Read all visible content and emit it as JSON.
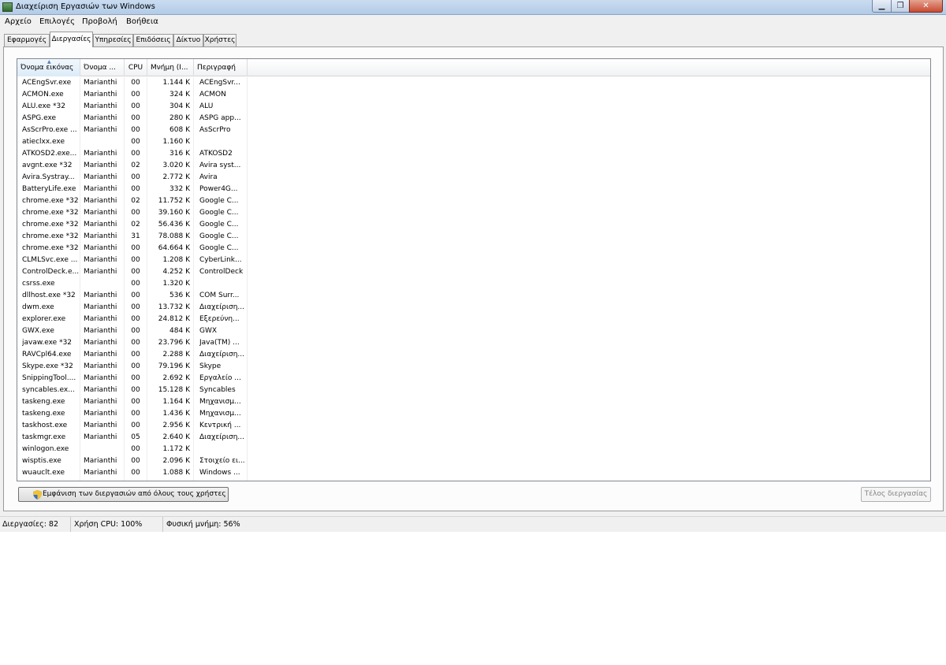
{
  "window": {
    "title": "Διαχείριση Εργασιών των Windows"
  },
  "title_buttons": {
    "minimize": "▁",
    "maximize": "❐",
    "close": "✕"
  },
  "menu": [
    "Αρχείο",
    "Επιλογές",
    "Προβολή",
    "Βοήθεια"
  ],
  "tabs": [
    "Εφαρμογές",
    "Διεργασίες",
    "Υπηρεσίες",
    "Επιδόσεις",
    "Δίκτυο",
    "Χρήστες"
  ],
  "active_tab": "Διεργασίες",
  "columns": [
    "Όνομα εικόνας",
    "Όνομα ...",
    "CPU",
    "Μνήμη (Ι...",
    "Περιγραφή"
  ],
  "sorted_column": "Όνομα εικόνας",
  "processes": [
    [
      "ACEngSvr.exe",
      "Marianthi",
      "00",
      "1.144 K",
      "ACEngSvr..."
    ],
    [
      "ACMON.exe",
      "Marianthi",
      "00",
      "324 K",
      "ACMON"
    ],
    [
      "ALU.exe *32",
      "Marianthi",
      "00",
      "304 K",
      "ALU"
    ],
    [
      "ASPG.exe",
      "Marianthi",
      "00",
      "280 K",
      "ASPG app..."
    ],
    [
      "AsScrPro.exe ...",
      "Marianthi",
      "00",
      "608 K",
      "AsScrPro"
    ],
    [
      "atieclxx.exe",
      "",
      "00",
      "1.160 K",
      ""
    ],
    [
      "ATKOSD2.exe...",
      "Marianthi",
      "00",
      "316 K",
      "ATKOSD2"
    ],
    [
      "avgnt.exe *32",
      "Marianthi",
      "02",
      "3.020 K",
      "Avira syst..."
    ],
    [
      "Avira.Systray...",
      "Marianthi",
      "00",
      "2.772 K",
      "Avira"
    ],
    [
      "BatteryLife.exe",
      "Marianthi",
      "00",
      "332 K",
      "Power4G..."
    ],
    [
      "chrome.exe *32",
      "Marianthi",
      "02",
      "11.752 K",
      "Google C..."
    ],
    [
      "chrome.exe *32",
      "Marianthi",
      "00",
      "39.160 K",
      "Google C..."
    ],
    [
      "chrome.exe *32",
      "Marianthi",
      "02",
      "56.436 K",
      "Google C..."
    ],
    [
      "chrome.exe *32",
      "Marianthi",
      "31",
      "78.088 K",
      "Google C..."
    ],
    [
      "chrome.exe *32",
      "Marianthi",
      "00",
      "64.664 K",
      "Google C..."
    ],
    [
      "CLMLSvc.exe ...",
      "Marianthi",
      "00",
      "1.208 K",
      "CyberLink..."
    ],
    [
      "ControlDeck.e...",
      "Marianthi",
      "00",
      "4.252 K",
      "ControlDeck"
    ],
    [
      "csrss.exe",
      "",
      "00",
      "1.320 K",
      ""
    ],
    [
      "dllhost.exe *32",
      "Marianthi",
      "00",
      "536 K",
      "COM Surr..."
    ],
    [
      "dwm.exe",
      "Marianthi",
      "00",
      "13.732 K",
      "Διαχείριση..."
    ],
    [
      "explorer.exe",
      "Marianthi",
      "00",
      "24.812 K",
      "Εξερεύνη..."
    ],
    [
      "GWX.exe",
      "Marianthi",
      "00",
      "484 K",
      "GWX"
    ],
    [
      "javaw.exe *32",
      "Marianthi",
      "00",
      "23.796 K",
      "Java(TM) ..."
    ],
    [
      "RAVCpl64.exe",
      "Marianthi",
      "00",
      "2.288 K",
      "Διαχείριση..."
    ],
    [
      "Skype.exe *32",
      "Marianthi",
      "00",
      "79.196 K",
      "Skype"
    ],
    [
      "SnippingTool....",
      "Marianthi",
      "00",
      "2.692 K",
      "Εργαλείο ..."
    ],
    [
      "syncables.ex...",
      "Marianthi",
      "00",
      "15.128 K",
      "Syncables"
    ],
    [
      "taskeng.exe",
      "Marianthi",
      "00",
      "1.164 K",
      "Μηχανισμ..."
    ],
    [
      "taskeng.exe",
      "Marianthi",
      "00",
      "1.436 K",
      "Μηχανισμ..."
    ],
    [
      "taskhost.exe",
      "Marianthi",
      "00",
      "2.956 K",
      "Κεντρική ..."
    ],
    [
      "taskmgr.exe",
      "Marianthi",
      "05",
      "2.640 K",
      "Διαχείριση..."
    ],
    [
      "winlogon.exe",
      "",
      "00",
      "1.172 K",
      ""
    ],
    [
      "wisptis.exe",
      "Marianthi",
      "00",
      "2.096 K",
      "Στοιχείο ει..."
    ],
    [
      "wuauclt.exe",
      "Marianthi",
      "00",
      "1.088 K",
      "Windows ..."
    ]
  ],
  "buttons": {
    "show_all": "Εμφάνιση των διεργασιών από όλους τους χρήστες",
    "end_task": "Τέλος διεργασίας"
  },
  "status": {
    "processes": "Διεργασίες: 82",
    "cpu": "Χρήση CPU: 100%",
    "memory": "Φυσική μνήμη: 56%"
  },
  "icons": {
    "app": "task-manager-icon",
    "shield": "uac-shield-icon"
  }
}
